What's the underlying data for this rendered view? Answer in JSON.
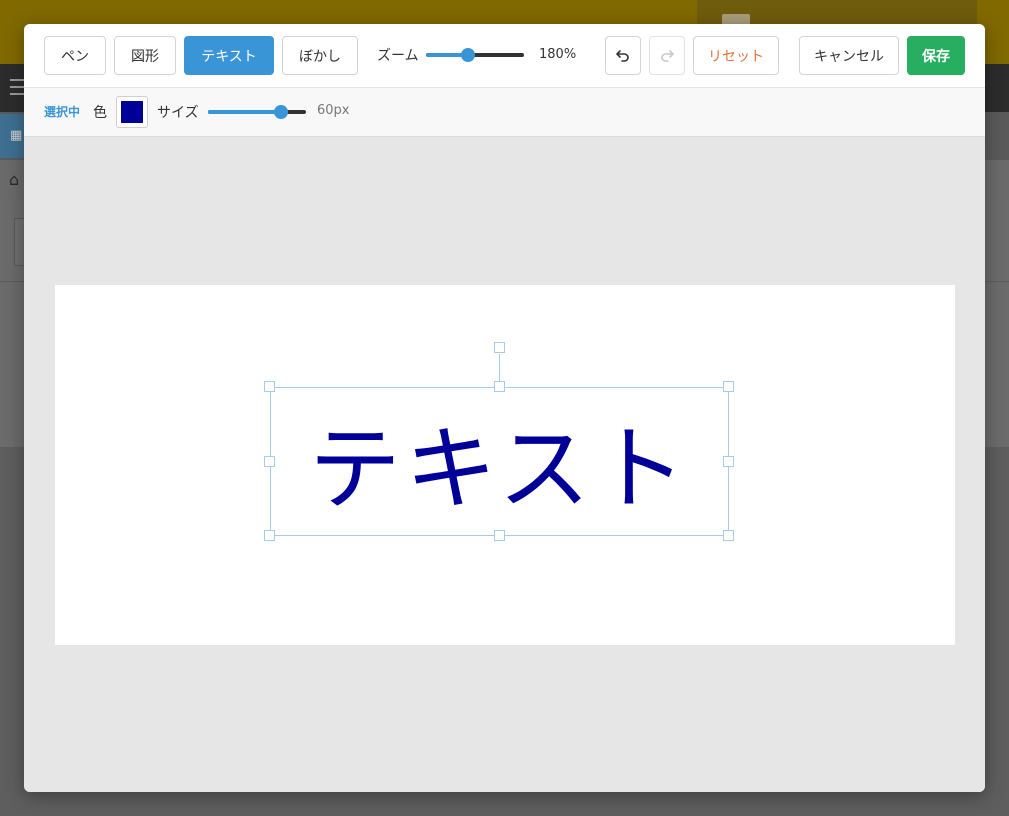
{
  "toolbar": {
    "pen_label": "ペン",
    "shape_label": "図形",
    "text_label": "テキスト",
    "blur_label": "ぼかし",
    "zoom_label": "ズーム",
    "zoom_value": "180%",
    "zoom_level": 0.42,
    "undo_icon": "undo-icon",
    "redo_icon": "redo-icon",
    "reset_label": "リセット",
    "cancel_label": "キャンセル",
    "save_label": "保存"
  },
  "options": {
    "selected_label": "選択中",
    "color_label": "色",
    "color_value": "#000099",
    "size_label": "サイズ",
    "size_value": "60px",
    "size_level": 0.78
  },
  "canvas": {
    "text": "テキスト",
    "text_color": "#000099"
  },
  "colors": {
    "accent": "#3a95d6",
    "save": "#27ae60",
    "reset": "#e0733a"
  }
}
